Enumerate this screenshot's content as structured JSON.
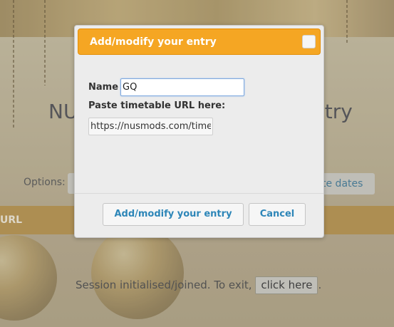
{
  "background": {
    "heading_left": "NU",
    "heading_right": "ntry",
    "options_label": "Options:",
    "dates_button": "te dates",
    "table_header_url": "URL",
    "session_text": "Session initialised/joined. To exit,",
    "session_button": "click here",
    "session_suffix": "."
  },
  "dialog": {
    "title": "Add/modify your entry",
    "name_label": "Name",
    "name_value": "GQ",
    "url_label": "Paste timetable URL here:",
    "url_value": "https://nusmods.com/timetable",
    "submit_label": "Add/modify your entry",
    "cancel_label": "Cancel"
  },
  "colors": {
    "accent": "#f5a623",
    "button_text": "#2d86b8",
    "table_header": "#b9934a"
  }
}
